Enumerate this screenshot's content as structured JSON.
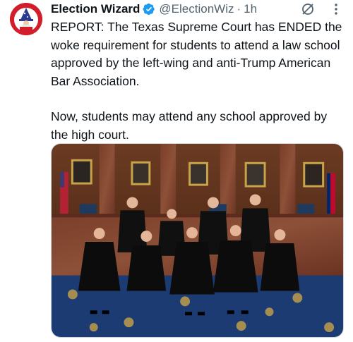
{
  "tweet": {
    "display_name": "Election Wizard",
    "handle": "@ElectionWiz",
    "separator": "·",
    "time": "1h",
    "paragraphs": [
      "REPORT: The Texas Supreme Court has ENDED the woke requirement for students to attend a law school approved by the left-wing and anti-Trump American Bar Association.",
      "Now, students may attend any school approved by the high court."
    ]
  },
  "icons": {
    "avatar": "wizard-avatar",
    "verified": "verified-badge-icon",
    "grok": "grok-icon",
    "more": "more-icon"
  },
  "colors": {
    "verified_blue": "#1d9bf0",
    "secondary_text": "#536471",
    "avatar_red": "#d21d2a"
  },
  "media": {
    "image": "photo of Texas Supreme Court justices in black robes in a wood-paneled courtroom"
  }
}
